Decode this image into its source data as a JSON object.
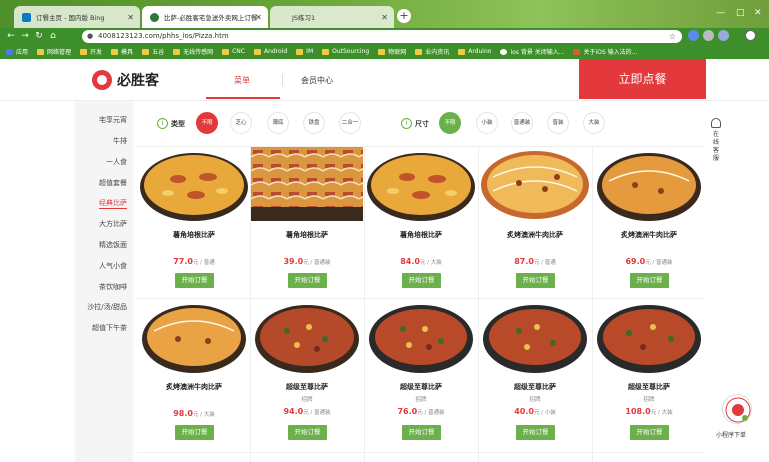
{
  "browser": {
    "tabs": [
      {
        "title": "订餐主页 - 国内版 Bing",
        "active": false
      },
      {
        "title": "比萨-必胜客宅急送外卖网上订餐",
        "active": true
      },
      {
        "title": "JS练习1",
        "active": false
      }
    ],
    "new_tab": "+",
    "url": "4008123123.com/phhs_ios/Pizza.htm",
    "bookmarks": [
      "应用",
      "网络管理",
      "开发",
      "模具",
      "五谷",
      "无线传感网",
      "CNC",
      "Android",
      "IM",
      "OutSourcing",
      "物联网",
      "业内资讯",
      "Arduino",
      "ios 背景 关闭输入...",
      "关于iOS 输入法的..."
    ],
    "window_controls": [
      "—",
      "□",
      "✕"
    ]
  },
  "site": {
    "logo_text": "必胜客",
    "nav": {
      "menu": "菜单",
      "member": "会员中心"
    },
    "order_button": "立即点餐",
    "accent": "#e4393c",
    "green": "#6bb04a"
  },
  "sidebar": {
    "items": [
      "宅享元宵",
      "牛排",
      "一人食",
      "超值套餐",
      "经典比萨",
      "大方比萨",
      "精选饭面",
      "人气小食",
      "茶饮咖啡",
      "沙拉/汤/甜品",
      "超值下午茶"
    ],
    "active_index": 4
  },
  "filters": {
    "type_label": "类型",
    "type_options": [
      "不限",
      "芝心",
      "薄底",
      "铁盘",
      "二合一"
    ],
    "size_label": "尺寸",
    "size_options": [
      "不限",
      "小装",
      "普通装",
      "普装",
      "大装"
    ]
  },
  "products": [
    {
      "name": "薯角培根比萨",
      "sub": "",
      "price": "77.0",
      "unit": "元 / 普通",
      "button": "开始订餐"
    },
    {
      "name": "薯角培根比萨",
      "sub": "",
      "price": "39.0",
      "unit": "元 / 普通装",
      "button": "开始订餐"
    },
    {
      "name": "薯角培根比萨",
      "sub": "",
      "price": "84.0",
      "unit": "元 / 大装",
      "button": "开始订餐"
    },
    {
      "name": "炙烤澳洲牛肉比萨",
      "sub": "",
      "price": "87.0",
      "unit": "元 / 普通",
      "button": "开始订餐"
    },
    {
      "name": "炙烤澳洲牛肉比萨",
      "sub": "",
      "price": "69.0",
      "unit": "元 / 普通装",
      "button": "开始订餐"
    },
    {
      "name": "炙烤澳洲牛肉比萨",
      "sub": "",
      "price": "98.0",
      "unit": "元 / 大装",
      "button": "开始订餐"
    },
    {
      "name": "超级至尊比萨",
      "sub": "招牌",
      "price": "94.0",
      "unit": "元 / 普通装",
      "button": "开始订餐"
    },
    {
      "name": "超级至尊比萨",
      "sub": "招牌",
      "price": "76.0",
      "unit": "元 / 普通装",
      "button": "开始订餐"
    },
    {
      "name": "超级至尊比萨",
      "sub": "招牌",
      "price": "40.0",
      "unit": "元 / 小装",
      "button": "开始订餐"
    },
    {
      "name": "超级至尊比萨",
      "sub": "招牌",
      "price": "108.0",
      "unit": "元 / 大装",
      "button": "开始订餐"
    }
  ],
  "right_tools": {
    "service_text": "在线客服",
    "mini_program": "小程序下单"
  }
}
